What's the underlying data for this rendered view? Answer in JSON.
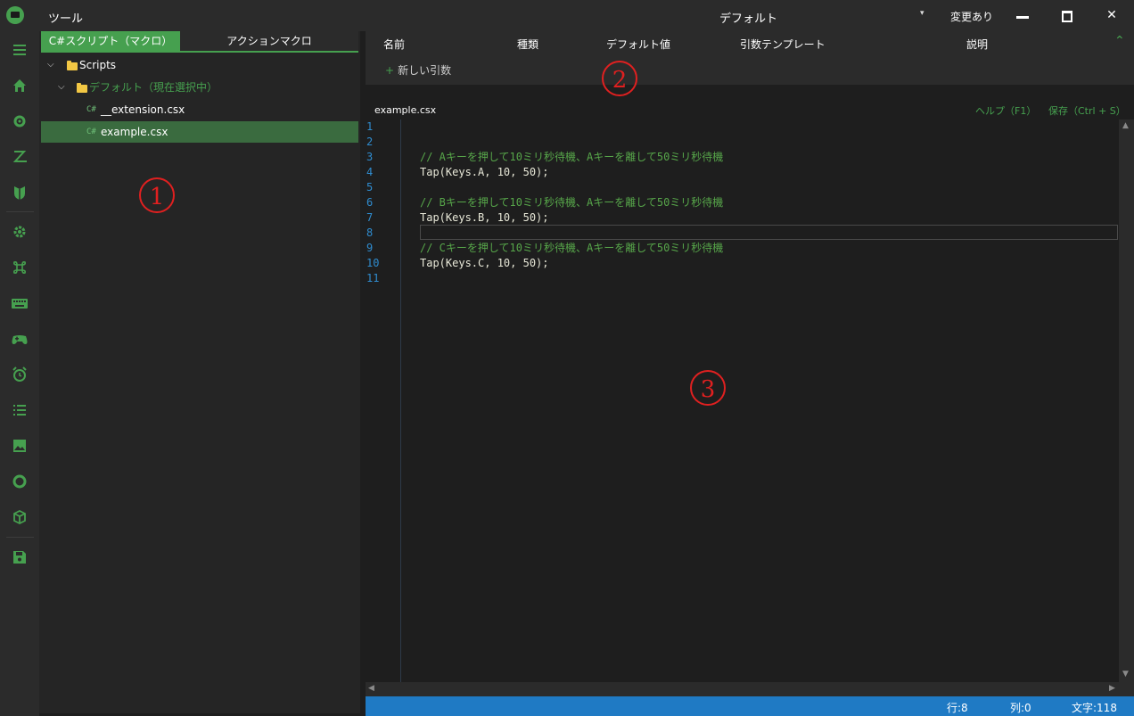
{
  "window": {
    "app_title": "ツール",
    "profile_name": "デフォルト",
    "profile_dropdown_glyph": "▾",
    "changes_status": "変更あり",
    "close_glyph": "✕"
  },
  "nav_rail": {
    "icons": [
      "menu-icon",
      "home-icon",
      "settings-icon",
      "z-icon",
      "shield-icon",
      "gear-icon",
      "command-icon",
      "keyboard-icon",
      "gamepad-icon",
      "alarm-icon",
      "list-icon",
      "image-icon",
      "circle-icon",
      "cube-icon",
      "save-icon"
    ]
  },
  "tree": {
    "tabs": {
      "csharp": "C#スクリプト（マクロ）",
      "action": "アクションマクロ"
    },
    "root": "Scripts",
    "folder": "デフォルト（現在選択中）",
    "cs_tag": "C#",
    "files": [
      "__extension.csx",
      "example.csx"
    ]
  },
  "arguments": {
    "columns": {
      "name": "名前",
      "type": "種類",
      "default": "デフォルト値",
      "template": "引数テンプレート",
      "description": "説明"
    },
    "new_argument": "新しい引数",
    "plus_glyph": "+",
    "collapse_glyph": "⌃"
  },
  "editor": {
    "file_tab": "example.csx",
    "help": "ヘルプ（F1）",
    "save": "保存（Ctrl + S）",
    "line_numbers": [
      "1",
      "2",
      "3",
      "4",
      "5",
      "6",
      "7",
      "8",
      "9",
      "10",
      "11"
    ],
    "lines": {
      "l3": "// Aキーを押して10ミリ秒待機、Aキーを離して50ミリ秒待機",
      "l4": "Tap(Keys.A, 10, 50);",
      "l6": "// Bキーを押して10ミリ秒待機、Aキーを離して50ミリ秒待機",
      "l7": "Tap(Keys.B, 10, 50);",
      "l9": "// Cキーを押して10ミリ秒待機、Aキーを離して50ミリ秒待機",
      "l10": "Tap(Keys.C, 10, 50);"
    }
  },
  "status": {
    "row": "行:8",
    "col": "列:0",
    "chars": "文字:118"
  },
  "annotations": {
    "a1": "1",
    "a2": "2",
    "a3": "3"
  },
  "colors": {
    "accent": "#46a04f",
    "status_bar": "#1f7ac4",
    "comment": "#57a64a",
    "annotation": "#e02020"
  }
}
